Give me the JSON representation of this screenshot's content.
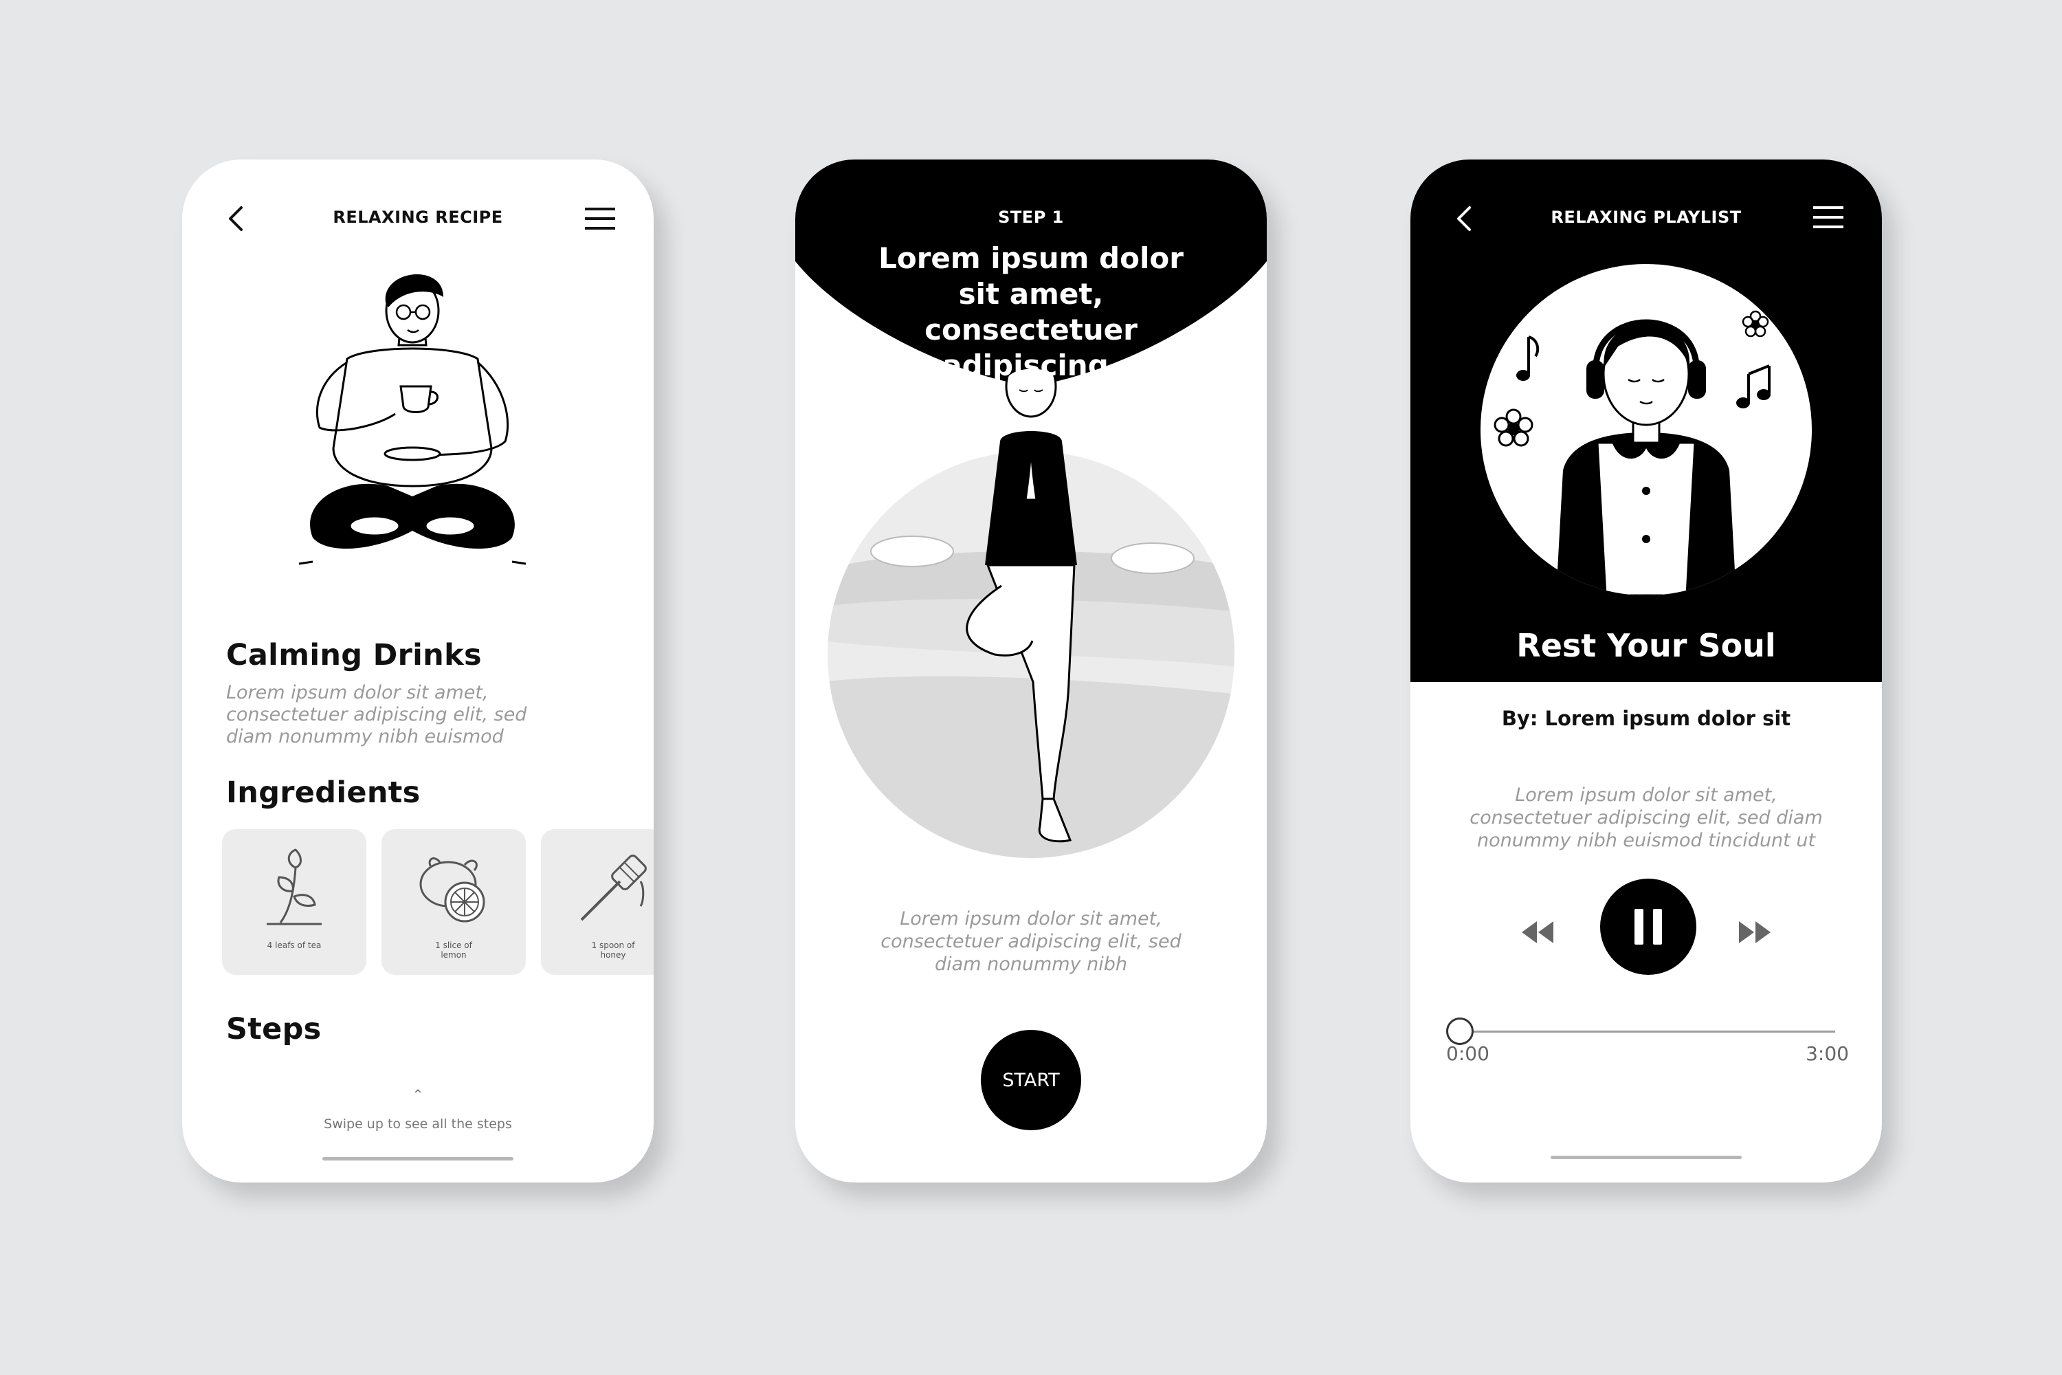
{
  "recipe": {
    "title": "RELAXING RECIPE",
    "heading": "Calming Drinks",
    "description": "Lorem ipsum dolor sit amet, consectetuer adipiscing elit, sed diam nonummy nibh euismod",
    "ingredients_title": "Ingredients",
    "ingredients": [
      {
        "icon": "tea-leaf-icon",
        "label": "4 leafs of tea"
      },
      {
        "icon": "lemon-icon",
        "label": "1 slice of lemon"
      },
      {
        "icon": "honey-dipper-icon",
        "label": "1 spoon of honey"
      }
    ],
    "steps_title": "Steps",
    "swipe_hint": "Swipe up to see all the steps"
  },
  "step": {
    "label": "STEP 1",
    "heading": "Lorem ipsum dolor sit amet, consectetuer adipiscing.",
    "description": "Lorem ipsum dolor sit amet, consectetuer adipiscing elit, sed diam nonummy nibh",
    "start_label": "START"
  },
  "playlist": {
    "title": "RELAXING PLAYLIST",
    "track_title": "Rest Your Soul",
    "artist": "By: Lorem ipsum dolor sit",
    "description": "Lorem ipsum dolor sit amet, consectetuer adipiscing elit, sed diam nonummy nibh euismod tincidunt ut",
    "time_current": "0:00",
    "time_total": "3:00",
    "progress": 0.0,
    "state": "playing"
  },
  "colors": {
    "background": "#e6e7e9",
    "black": "#000000",
    "card": "#ececec",
    "muted_text": "#9a9a9a"
  }
}
